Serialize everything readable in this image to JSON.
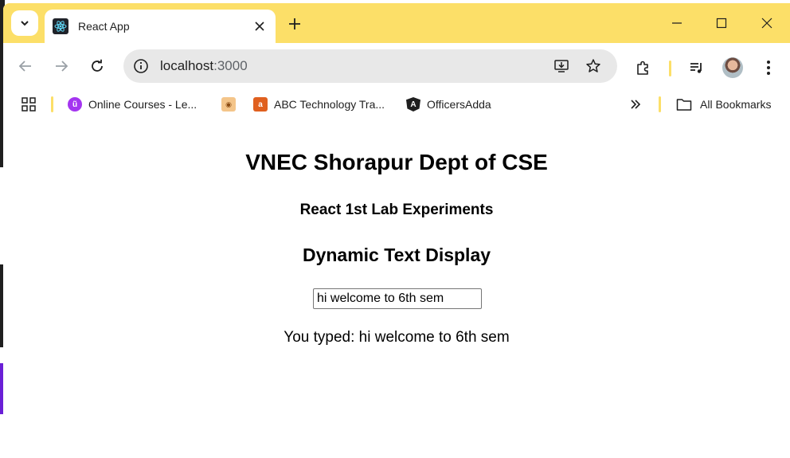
{
  "browser": {
    "tab": {
      "title": "React App"
    },
    "omnibox": {
      "host": "localhost",
      "port": ":3000"
    },
    "bookmarks": [
      {
        "label": "Online Courses - Le...",
        "icon": "udemy-icon",
        "color": "#a435f0"
      },
      {
        "label": "",
        "icon": "food-icon",
        "color": "#d9822b"
      },
      {
        "label": "ABC Technology Tra...",
        "icon": "abc-icon",
        "color": "#e0601f"
      },
      {
        "label": "OfficersAdda",
        "icon": "angular-icon",
        "color": "#1f1f1f"
      }
    ],
    "all_bookmarks_label": "All Bookmarks",
    "accent_color": "#fcdf68"
  },
  "page": {
    "heading": "VNEC Shorapur Dept of CSE",
    "subheading": "React 1st Lab Experiments",
    "section_title": "Dynamic Text Display",
    "input_value": "hi welcome to 6th sem",
    "output_text": "You typed: hi welcome to 6th sem"
  }
}
